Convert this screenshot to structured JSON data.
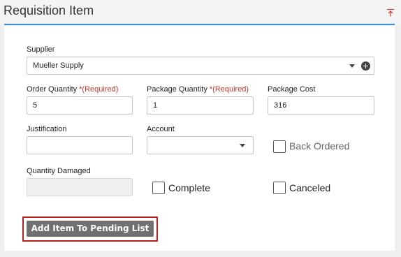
{
  "panel": {
    "title": "Requisition Item",
    "collapse_icon": "collapse-up-icon"
  },
  "fields": {
    "supplier": {
      "label": "Supplier",
      "value": "Mueller Supply"
    },
    "order_quantity": {
      "label": "Order Quantity",
      "required": "*(Required)",
      "value": "5"
    },
    "package_quantity": {
      "label": "Package Quantity",
      "required": "*(Required)",
      "value": "1"
    },
    "package_cost": {
      "label": "Package Cost",
      "value": "316"
    },
    "justification": {
      "label": "Justification",
      "value": ""
    },
    "account": {
      "label": "Account",
      "value": ""
    },
    "quantity_damaged": {
      "label": "Quantity Damaged",
      "value": ""
    }
  },
  "checkboxes": {
    "back_ordered": {
      "label": "Back Ordered",
      "checked": false
    },
    "complete": {
      "label": "Complete",
      "checked": false
    },
    "canceled": {
      "label": "Canceled",
      "checked": false
    }
  },
  "actions": {
    "add_item_label": "Add Item To Pending List"
  },
  "colors": {
    "accent": "#3a8fd6",
    "required": "#c0392b",
    "button": "#707070",
    "highlight": "#b22222"
  }
}
